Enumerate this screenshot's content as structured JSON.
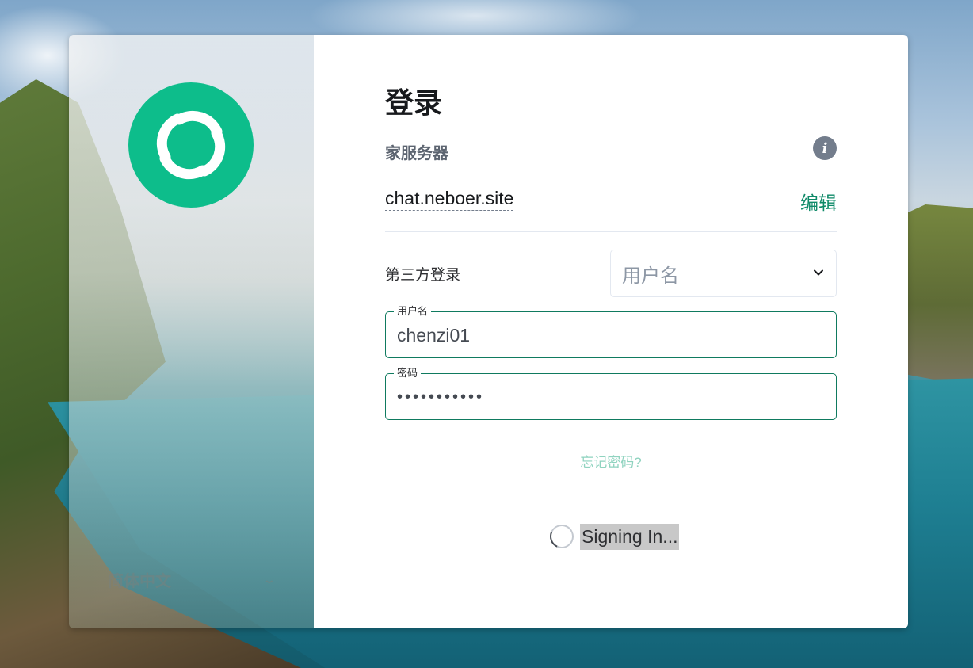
{
  "login": {
    "title": "登录",
    "homeserver_label": "家服务器",
    "homeserver_name": "chat.neboer.site",
    "edit_label": "编辑",
    "third_party_label": "第三方登录",
    "third_party_select_value": "用户名",
    "username_label": "用户名",
    "username_value": "chenzi01",
    "password_label": "密码",
    "password_value": "•••••••••••",
    "forgot_password": "忘记密码?",
    "signing_in": "Signing In..."
  },
  "language": {
    "selected": "简体中文"
  },
  "icons": {
    "logo": "element-logo",
    "info": "info-icon",
    "select_chevron": "chevron-down-icon",
    "language_chevron": "chevron-down-icon",
    "spinner": "spinner-icon"
  },
  "colors": {
    "accent": "#0dbd8b",
    "field_border": "#0f7a5f",
    "link": "#8fd3bf"
  }
}
